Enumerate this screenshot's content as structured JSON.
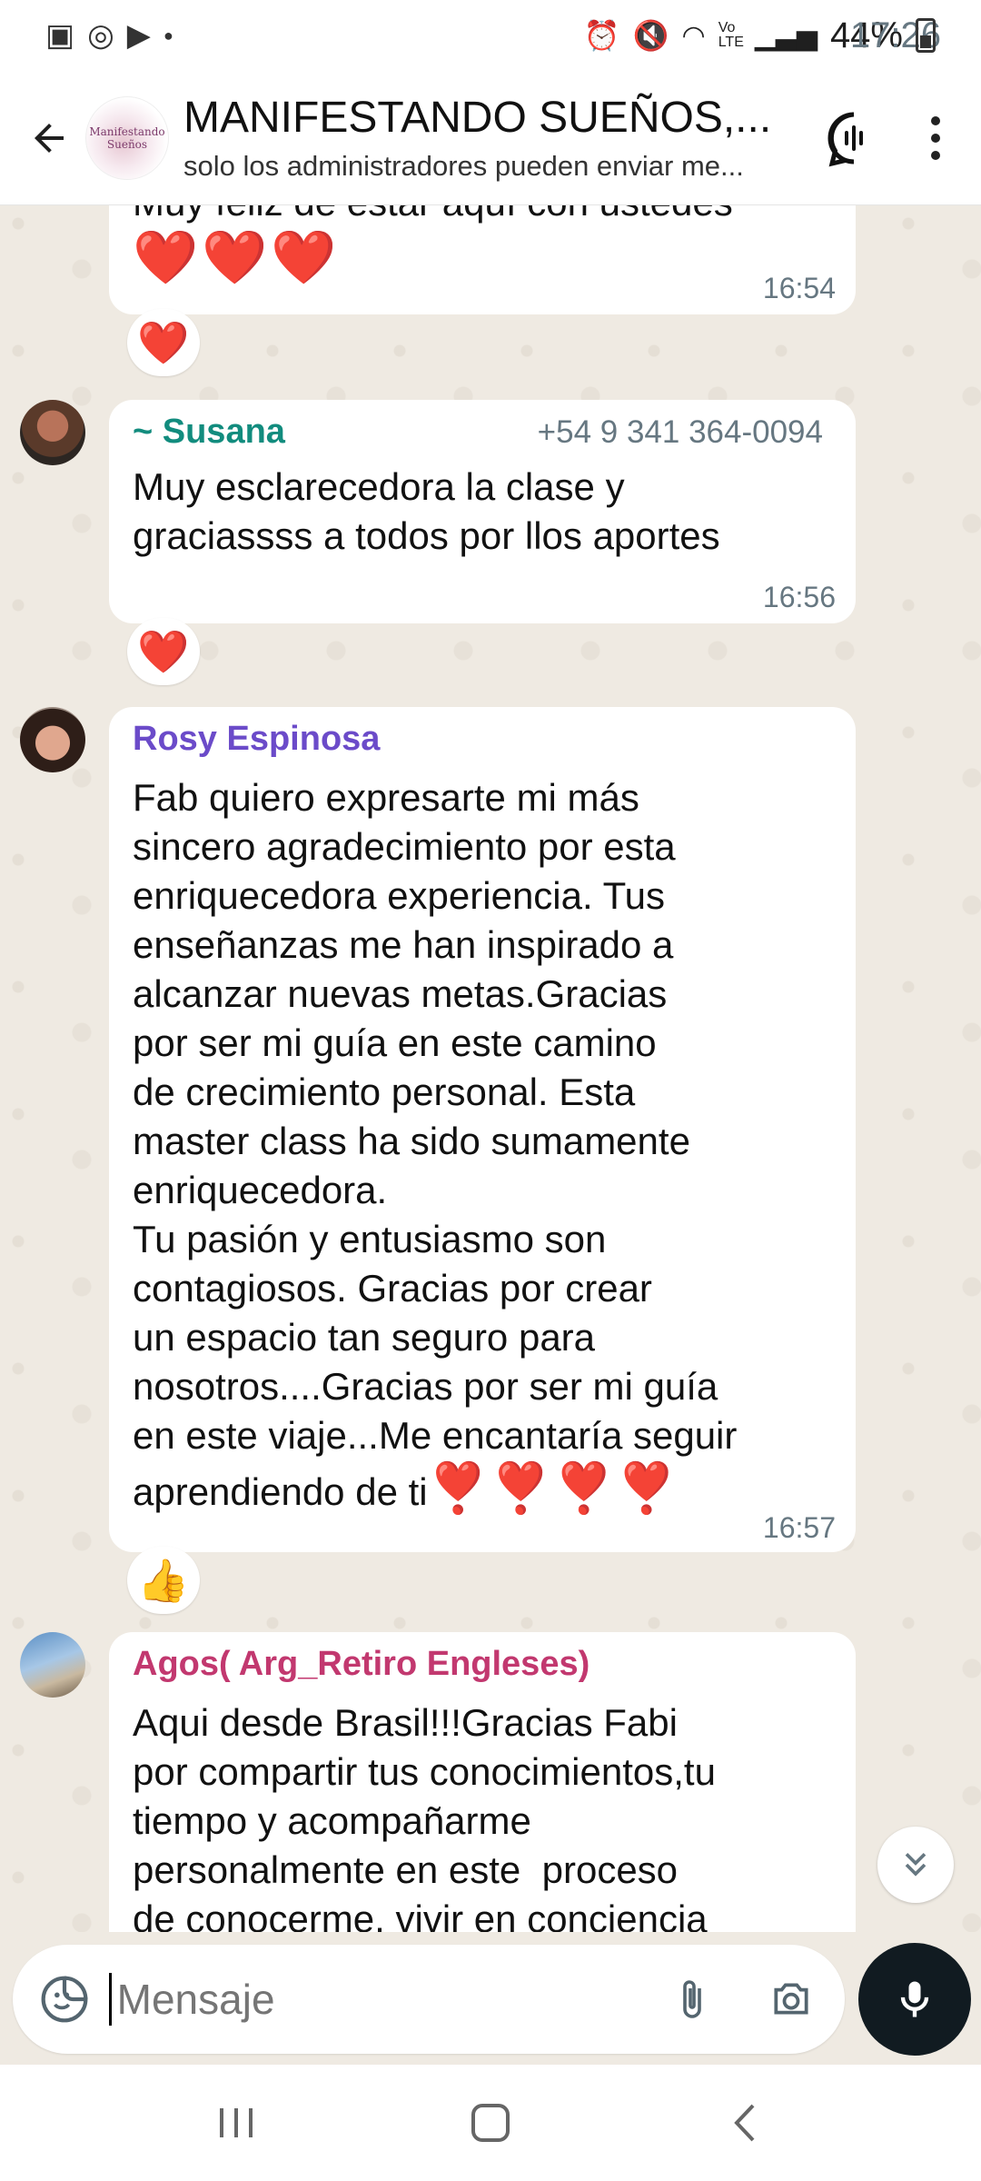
{
  "status_bar": {
    "time": "17:26",
    "battery": "44%",
    "network": "Vo LTE"
  },
  "header": {
    "title": "MANIFESTANDO SUEÑOS,...",
    "subtitle": "solo los administradores pueden enviar me...",
    "avatar_text": "Manifestando Sueños"
  },
  "messages": [
    {
      "text": "Muy feliz de estar aquí con ustedes",
      "hearts": "❤️❤️❤️",
      "time": "16:54",
      "reaction": "❤️"
    },
    {
      "sender": "~ Susana",
      "sender_color": "#128c7e",
      "phone": "+54 9 341 364-0094",
      "text": "Muy esclarecedora la clase y\ngraciassss a todos por llos aportes",
      "time": "16:56",
      "reaction": "❤️"
    },
    {
      "sender": "Rosy Espinosa",
      "sender_color": "#6b4bc9",
      "text": "Fab quiero expresarte mi más\nsincero agradecimiento por esta\nenriquecedora experiencia. Tus\nenseñanzas me han inspirado a\nalcanzar nuevas metas.Gracias\npor ser mi guía en este camino\nde crecimiento personal. Esta\nmaster class ha sido sumamente\nenriquecedora.\nTu pasión y entusiasmo son\ncontagiosos. Gracias por crear\nun espacio tan seguro para\nnosotros....Gracias por ser mi guía\nen este viaje...Me encantaría seguir\naprendiendo de ti",
      "trailing_emoji": "❣️❣️❣️❣️",
      "time": "16:57",
      "reaction": "👍"
    },
    {
      "sender": "Agos( Arg_Retiro Engleses)",
      "sender_color": "#c2386f",
      "text": "Aqui desde Brasil!!!Gracias Fabi\npor compartir tus conocimientos,tu\ntiempo y acompañarme\npersonalmente en este  proceso\nde conocerme, vivir en conciencia"
    }
  ],
  "composer": {
    "placeholder": "Mensaje"
  },
  "colors": {
    "accent": "#128c7e",
    "background": "#efeae2",
    "mic_button": "#111b21"
  }
}
